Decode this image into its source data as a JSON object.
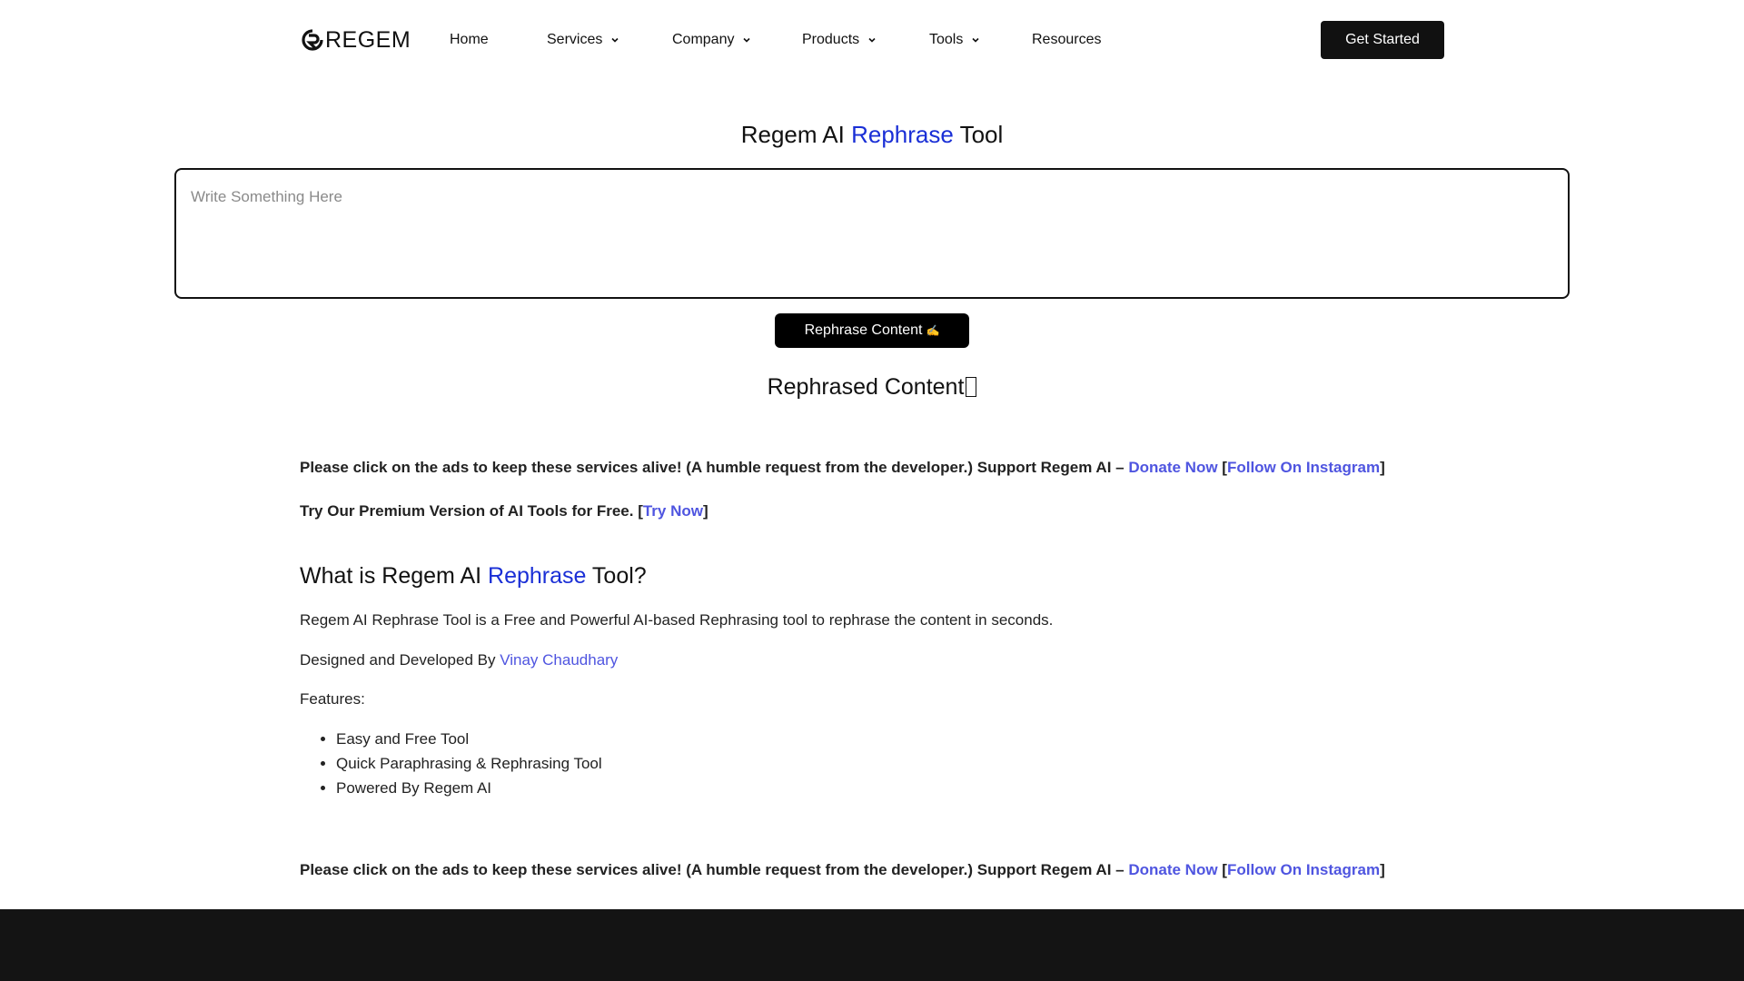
{
  "header": {
    "logo_text": "REGEM",
    "nav": [
      {
        "label": "Home",
        "has_dropdown": false
      },
      {
        "label": "Services",
        "has_dropdown": true
      },
      {
        "label": "Company",
        "has_dropdown": true
      },
      {
        "label": "Products",
        "has_dropdown": true
      },
      {
        "label": "Tools",
        "has_dropdown": true
      },
      {
        "label": "Resources",
        "has_dropdown": false
      }
    ],
    "cta_label": "Get Started"
  },
  "tool": {
    "title_prefix": "Regem AI ",
    "title_accent": "Rephrase",
    "title_suffix": " Tool",
    "input_placeholder": "Write Something Here",
    "button_label": "Rephrase Content",
    "button_icon": "✍",
    "result_title": "Rephrased Content"
  },
  "notice": {
    "text": "Please click on the ads to keep these services alive! (A humble request from the developer.) Support Regem AI – ",
    "donate_label": "Donate Now",
    "open_bracket": " [",
    "instagram_label": "Follow On Instagram",
    "close_bracket": "]"
  },
  "premium": {
    "text": "Try Our Premium Version of AI Tools for Free. [",
    "link_label": "Try Now",
    "close_bracket": "]"
  },
  "about": {
    "heading_prefix": "What is Regem AI ",
    "heading_accent": "Rephrase",
    "heading_suffix": " Tool?",
    "description": "Regem AI Rephrase Tool is a Free and Powerful AI-based Rephrasing tool to rephrase the content in seconds.",
    "designed_by_text": "Designed and Developed By ",
    "designer_name": "Vinay Chaudhary",
    "features_label": "Features:",
    "features": [
      "Easy and Free Tool",
      "Quick Paraphrasing & Rephrasing Tool",
      "Powered By Regem AI"
    ]
  },
  "colors": {
    "accent": "#1a2fd6",
    "link": "#4f55e0",
    "button_bg": "#000000",
    "footer_bg": "#141414"
  }
}
